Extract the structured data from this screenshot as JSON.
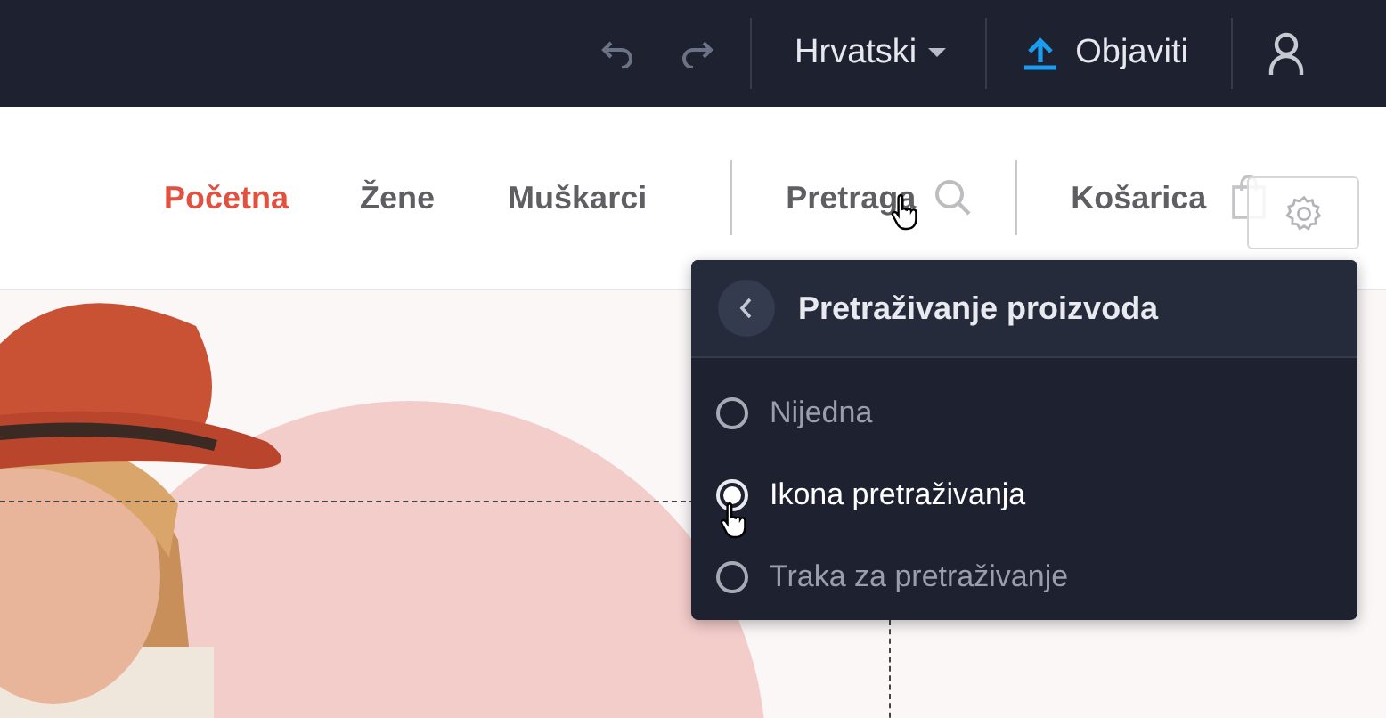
{
  "top_bar": {
    "language": "Hrvatski",
    "publish_button": "Objaviti"
  },
  "nav": {
    "items": [
      {
        "label": "Početna",
        "selected": true,
        "kind": "link"
      },
      {
        "label": "Žene",
        "selected": false,
        "kind": "link"
      },
      {
        "label": "Muškarci",
        "selected": false,
        "kind": "link"
      },
      {
        "label": "Pretraga",
        "selected": false,
        "kind": "search"
      },
      {
        "label": "Košarica",
        "selected": false,
        "kind": "cart"
      }
    ]
  },
  "popup": {
    "title": "Pretraživanje proizvoda",
    "options": [
      {
        "label": "Nijedna",
        "selected": false
      },
      {
        "label": "Ikona pretraživanja",
        "selected": true
      },
      {
        "label": "Traka za pretraživanje",
        "selected": false
      }
    ]
  }
}
